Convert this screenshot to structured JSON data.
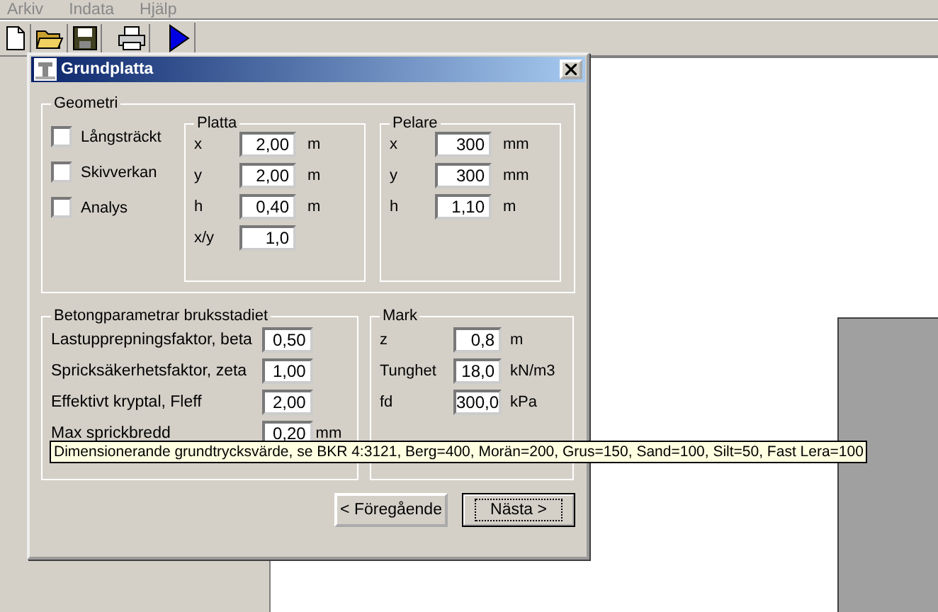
{
  "menu": [
    "Arkiv",
    "Indata",
    "Hjälp"
  ],
  "dialog": {
    "title": "Grundplatta",
    "geometry": {
      "title": "Geometri",
      "checkboxes": [
        {
          "label": "Långsträckt",
          "checked": false
        },
        {
          "label": "Skivverkan",
          "checked": false
        },
        {
          "label": "Analys",
          "checked": false
        }
      ],
      "platta": {
        "title": "Platta",
        "rows": [
          {
            "label": "x",
            "value": "2,00",
            "unit": "m"
          },
          {
            "label": "y",
            "value": "2,00",
            "unit": "m"
          },
          {
            "label": "h",
            "value": "0,40",
            "unit": "m"
          },
          {
            "label": "x/y",
            "value": "1,0"
          }
        ]
      },
      "pelare": {
        "title": "Pelare",
        "rows": [
          {
            "label": "x",
            "value": "300",
            "unit": "mm"
          },
          {
            "label": "y",
            "value": "300",
            "unit": "mm"
          },
          {
            "label": "h",
            "value": "1,10",
            "unit": "m"
          }
        ]
      }
    },
    "betong": {
      "title": "Betongparametrar bruksstadiet",
      "rows": [
        {
          "label": "Lastupprepningsfaktor, beta",
          "value": "0,50"
        },
        {
          "label": "Spricksäkerhetsfaktor, zeta",
          "value": "1,00"
        },
        {
          "label": "Effektivt kryptal, Fleff",
          "value": "2,00"
        },
        {
          "label": "Max sprickbredd",
          "value": "0,20",
          "unit": "mm"
        }
      ]
    },
    "mark": {
      "title": "Mark",
      "rows": [
        {
          "label": "z",
          "value": "0,8",
          "unit": "m"
        },
        {
          "label": "Tunghet",
          "value": "18,0",
          "unit": "kN/m3"
        },
        {
          "label": "fd",
          "value": "300,0",
          "unit": "kPa"
        }
      ]
    },
    "buttons": [
      {
        "label": "< Föregående",
        "focused": false
      },
      {
        "label": "Nästa >",
        "focused": true
      }
    ],
    "tooltip": "Dimensionerande grundtrycksvärde, se BKR 4:3121, Berg=400, Morän=200, Grus=150, Sand=100, Silt=50, Fast Lera=100"
  }
}
